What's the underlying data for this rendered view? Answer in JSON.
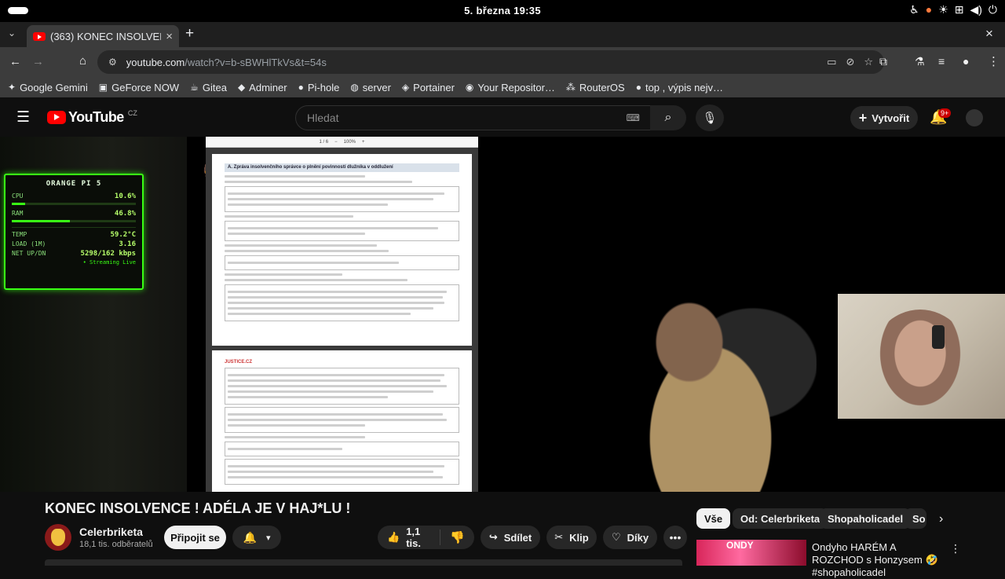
{
  "status_bar": {
    "clock": "5. března  19:35"
  },
  "tab": {
    "title": "(363) KONEC INSOLVENC",
    "close": "×",
    "new_tab": "+"
  },
  "address": {
    "host": "youtube.com",
    "path": "/watch?v=b-sBWHlTkVs&t=54s"
  },
  "bookmarks": [
    {
      "label": "Google Gemini",
      "icon": "✦"
    },
    {
      "label": "GeForce NOW",
      "icon": "▣"
    },
    {
      "label": "Gitea",
      "icon": "☕"
    },
    {
      "label": "Adminer",
      "icon": "◆"
    },
    {
      "label": "Pi-hole",
      "icon": "●"
    },
    {
      "label": "server",
      "icon": "◍"
    },
    {
      "label": "Portainer",
      "icon": "◈"
    },
    {
      "label": "Your Repositor…",
      "icon": "◉"
    },
    {
      "label": "RouterOS",
      "icon": "⁂"
    },
    {
      "label": "top , výpis nejv…",
      "icon": "●"
    }
  ],
  "youtube": {
    "logo": "YouTube",
    "region": "CZ",
    "search_placeholder": "Hledat",
    "create_label": "Vytvořit",
    "notif_count": "9+"
  },
  "overlay": {
    "title": "ORANGE PI 5",
    "cpu_label": "CPU",
    "cpu_value": "10.6%",
    "cpu_fill": 0.106,
    "ram_label": "RAM",
    "ram_value": "46.8%",
    "ram_fill": 0.468,
    "temp_label": "TEMP",
    "temp_value": "59.2°C",
    "load_label": "LOAD (1M)",
    "load_value": "3.16",
    "net_label": "NET UP/DN",
    "net_value": "5298/162 kbps",
    "live": "• Streaming Live"
  },
  "pdf": {
    "page_counter": "1 / 6",
    "zoom": "100%",
    "section_title": "A. Zpráva insolvenčního správce o plnění povinností dlužníka v oddlužení",
    "site": "JUSTICE.CZ"
  },
  "video": {
    "title": "KONEC INSOLVENCE ! ADÉLA JE V HAJ*LU !",
    "channel": "Celerbriketa",
    "subscribers": "18,1 tis. odběratelů",
    "subscribe_label": "Připojit se",
    "likes": "1,1 tis.",
    "share_label": "Sdílet",
    "clip_label": "Klip",
    "thanks_label": "Díky"
  },
  "chips": [
    "Vše",
    "Od: Celerbriketa",
    "Shopaholicadel",
    "So"
  ],
  "recommendation": {
    "thumb_text": "ONDY",
    "title": "Ondyho HARÉM A ROZCHOD s Honzysem 🤣 #shopaholicadel"
  }
}
